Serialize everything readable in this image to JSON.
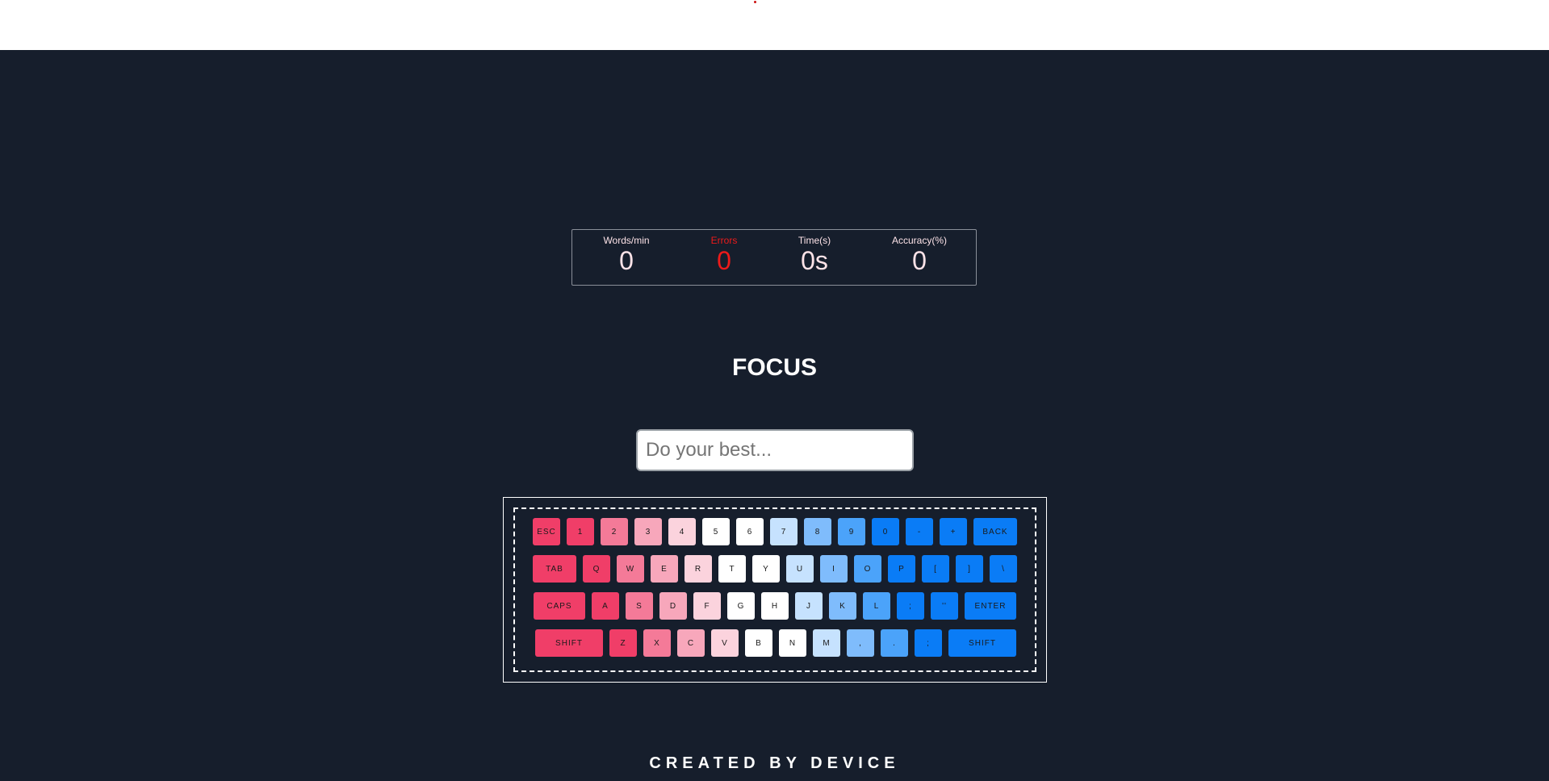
{
  "stats": {
    "wpm_label": "Words/min",
    "wpm_value": "0",
    "errors_label": "Errors",
    "errors_value": "0",
    "time_label": "Time(s)",
    "time_value": "0s",
    "accuracy_label": "Accuracy(%)",
    "accuracy_value": "0"
  },
  "title": "FOCUS",
  "input": {
    "placeholder": "Do your best...",
    "value": ""
  },
  "keyboard": {
    "rows": [
      [
        {
          "label": "ESC",
          "w": 34,
          "c": "#f03e68"
        },
        {
          "label": "1",
          "w": 34,
          "c": "#f03e68"
        },
        {
          "label": "2",
          "w": 34,
          "c": "#f47a98"
        },
        {
          "label": "3",
          "w": 34,
          "c": "#f7a7bb"
        },
        {
          "label": "4",
          "w": 34,
          "c": "#fbd3dd"
        },
        {
          "label": "5",
          "w": 34,
          "c": "#ffffff"
        },
        {
          "label": "6",
          "w": 34,
          "c": "#ffffff"
        },
        {
          "label": "7",
          "w": 34,
          "c": "#c6e2fe"
        },
        {
          "label": "8",
          "w": 34,
          "c": "#7fbcfc"
        },
        {
          "label": "9",
          "w": 34,
          "c": "#4ba3fa"
        },
        {
          "label": "0",
          "w": 34,
          "c": "#0a7cf6"
        },
        {
          "label": "-",
          "w": 34,
          "c": "#0a7cf6"
        },
        {
          "label": "+",
          "w": 34,
          "c": "#0a7cf6"
        },
        {
          "label": "BACK",
          "w": 54,
          "c": "#0a7cf6"
        }
      ],
      [
        {
          "label": "TAB",
          "w": 54,
          "c": "#f03e68"
        },
        {
          "label": "Q",
          "w": 34,
          "c": "#f03e68"
        },
        {
          "label": "W",
          "w": 34,
          "c": "#f47a98"
        },
        {
          "label": "E",
          "w": 34,
          "c": "#f7a7bb"
        },
        {
          "label": "R",
          "w": 34,
          "c": "#fbd3dd"
        },
        {
          "label": "T",
          "w": 34,
          "c": "#ffffff"
        },
        {
          "label": "Y",
          "w": 34,
          "c": "#ffffff"
        },
        {
          "label": "U",
          "w": 34,
          "c": "#c6e2fe"
        },
        {
          "label": "I",
          "w": 34,
          "c": "#7fbcfc"
        },
        {
          "label": "O",
          "w": 34,
          "c": "#4ba3fa"
        },
        {
          "label": "P",
          "w": 34,
          "c": "#0a7cf6"
        },
        {
          "label": "[",
          "w": 34,
          "c": "#0a7cf6"
        },
        {
          "label": "]",
          "w": 34,
          "c": "#0a7cf6"
        },
        {
          "label": "\\",
          "w": 34,
          "c": "#0a7cf6"
        }
      ],
      [
        {
          "label": "CAPS",
          "w": 64,
          "c": "#f03e68"
        },
        {
          "label": "A",
          "w": 34,
          "c": "#f03e68"
        },
        {
          "label": "S",
          "w": 34,
          "c": "#f47a98"
        },
        {
          "label": "D",
          "w": 34,
          "c": "#f7a7bb"
        },
        {
          "label": "F",
          "w": 34,
          "c": "#fbd3dd"
        },
        {
          "label": "G",
          "w": 34,
          "c": "#ffffff"
        },
        {
          "label": "H",
          "w": 34,
          "c": "#ffffff"
        },
        {
          "label": "J",
          "w": 34,
          "c": "#c6e2fe"
        },
        {
          "label": "K",
          "w": 34,
          "c": "#7fbcfc"
        },
        {
          "label": "L",
          "w": 34,
          "c": "#4ba3fa"
        },
        {
          "label": ";",
          "w": 34,
          "c": "#0a7cf6"
        },
        {
          "label": "''",
          "w": 34,
          "c": "#0a7cf6"
        },
        {
          "label": "ENTER",
          "w": 64,
          "c": "#0a7cf6"
        }
      ],
      [
        {
          "label": "SHIFT",
          "w": 84,
          "c": "#f03e68"
        },
        {
          "label": "Z",
          "w": 34,
          "c": "#f03e68"
        },
        {
          "label": "X",
          "w": 34,
          "c": "#f47a98"
        },
        {
          "label": "C",
          "w": 34,
          "c": "#f7a7bb"
        },
        {
          "label": "V",
          "w": 34,
          "c": "#fbd3dd"
        },
        {
          "label": "B",
          "w": 34,
          "c": "#ffffff"
        },
        {
          "label": "N",
          "w": 34,
          "c": "#ffffff"
        },
        {
          "label": "M",
          "w": 34,
          "c": "#c6e2fe"
        },
        {
          "label": ",",
          "w": 34,
          "c": "#7fbcfc"
        },
        {
          "label": ".",
          "w": 34,
          "c": "#4ba3fa"
        },
        {
          "label": ";",
          "w": 34,
          "c": "#0a7cf6"
        },
        {
          "label": "SHIFT",
          "w": 84,
          "c": "#0a7cf6"
        }
      ]
    ]
  },
  "footer": "CREATED BY DEVICE"
}
